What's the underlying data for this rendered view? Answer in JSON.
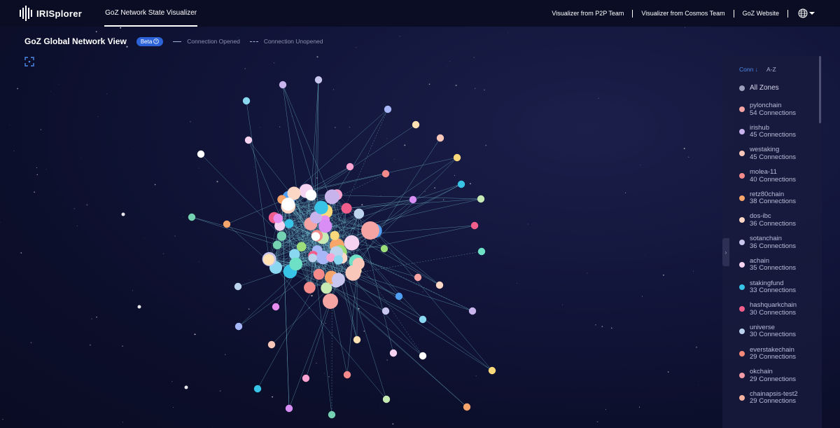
{
  "header": {
    "logo_text": "IRISplorer",
    "active_tab": "GoZ Network State Visualizer",
    "links": [
      "Visualizer from P2P Team",
      "Visualizer from Cosmos Team",
      "GoZ Website"
    ],
    "language_icon": "globe-icon"
  },
  "view": {
    "title": "GoZ Global Network View",
    "beta_label": "Beta",
    "legend_opened": "Connection Opened",
    "legend_unopened": "Connection Unopened"
  },
  "panel": {
    "sort_conn_label": "Conn ↓",
    "sort_az_label": "A-Z",
    "all_zones_label": "All Zones",
    "zones": [
      {
        "name": "pylonchain",
        "count": "54 Connections",
        "color": "#f5a3a3"
      },
      {
        "name": "irishub",
        "count": "45 Connections",
        "color": "#c9b3ec"
      },
      {
        "name": "westaking",
        "count": "45 Connections",
        "color": "#f9c7b9"
      },
      {
        "name": "molea-11",
        "count": "40 Connections",
        "color": "#f58a8a"
      },
      {
        "name": "retz80chain",
        "count": "38 Connections",
        "color": "#f7a56b"
      },
      {
        "name": "dos-ibc",
        "count": "36 Connections",
        "color": "#fcd7c6"
      },
      {
        "name": "sotanchain",
        "count": "36 Connections",
        "color": "#c8c6ee"
      },
      {
        "name": "achain",
        "count": "35 Connections",
        "color": "#f6d3f0"
      },
      {
        "name": "stakingfund",
        "count": "33 Connections",
        "color": "#38c4e6"
      },
      {
        "name": "hashquarkchain",
        "count": "30 Connections",
        "color": "#f25e8b"
      },
      {
        "name": "universe",
        "count": "30 Connections",
        "color": "#bcd3ee"
      },
      {
        "name": "everstakechain",
        "count": "29 Connections",
        "color": "#f58a7a"
      },
      {
        "name": "okchain",
        "count": "29 Connections",
        "color": "#f29aa6"
      },
      {
        "name": "chainapsis-test2",
        "count": "29 Connections",
        "color": "#f8b3a0"
      }
    ]
  },
  "graph": {
    "colors": [
      "#f5a3a3",
      "#c9b3ec",
      "#f9c7b9",
      "#f58a8a",
      "#f7a56b",
      "#fcd7c6",
      "#c8c6ee",
      "#f6d3f0",
      "#38c4e6",
      "#f25e8b",
      "#bcd3ee",
      "#8ad7f2",
      "#ffffff",
      "#c7e9b4",
      "#6ee0c5",
      "#4fa0f5",
      "#a7b6f7",
      "#fbd97a",
      "#d98ef5",
      "#9bde7a",
      "#e88df0",
      "#ffe1b3",
      "#f9a3d0",
      "#74d1b2"
    ],
    "edge_color": "#7fd6e6",
    "background": "#12153a"
  }
}
